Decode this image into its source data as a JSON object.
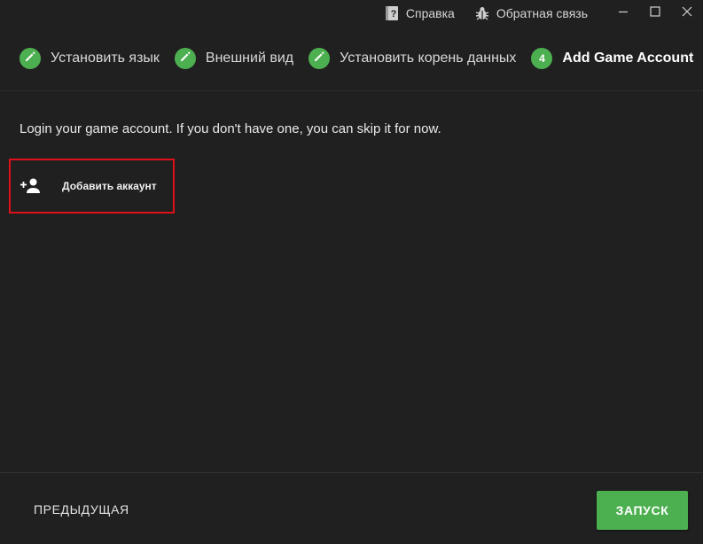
{
  "titlebar": {
    "help_label": "Справка",
    "help_icon": "help-book-icon",
    "feedback_label": "Обратная связь",
    "feedback_icon": "bug-icon",
    "minimize_icon": "minimize-icon",
    "maximize_icon": "maximize-icon",
    "close_icon": "close-icon"
  },
  "stepper": {
    "steps": [
      {
        "label": "Установить язык",
        "state": "completed",
        "icon": "pencil-icon"
      },
      {
        "label": "Внешний вид",
        "state": "completed",
        "icon": "pencil-icon"
      },
      {
        "label": "Установить корень данных",
        "state": "completed",
        "icon": "pencil-icon"
      },
      {
        "label": "Add Game Account",
        "state": "active",
        "number": "4"
      }
    ]
  },
  "content": {
    "intro": "Login your game account. If you don't have one, you can skip it for now.",
    "add_account_label": "Добавить аккаунт",
    "add_account_icon": "person-add-icon"
  },
  "footer": {
    "prev_label": "ПРЕДЫДУЩАЯ",
    "launch_label": "ЗАПУСК"
  },
  "colors": {
    "background": "#202020",
    "accent": "#4caf50",
    "highlight_border": "#e0101a",
    "text": "#e0e0e0"
  }
}
